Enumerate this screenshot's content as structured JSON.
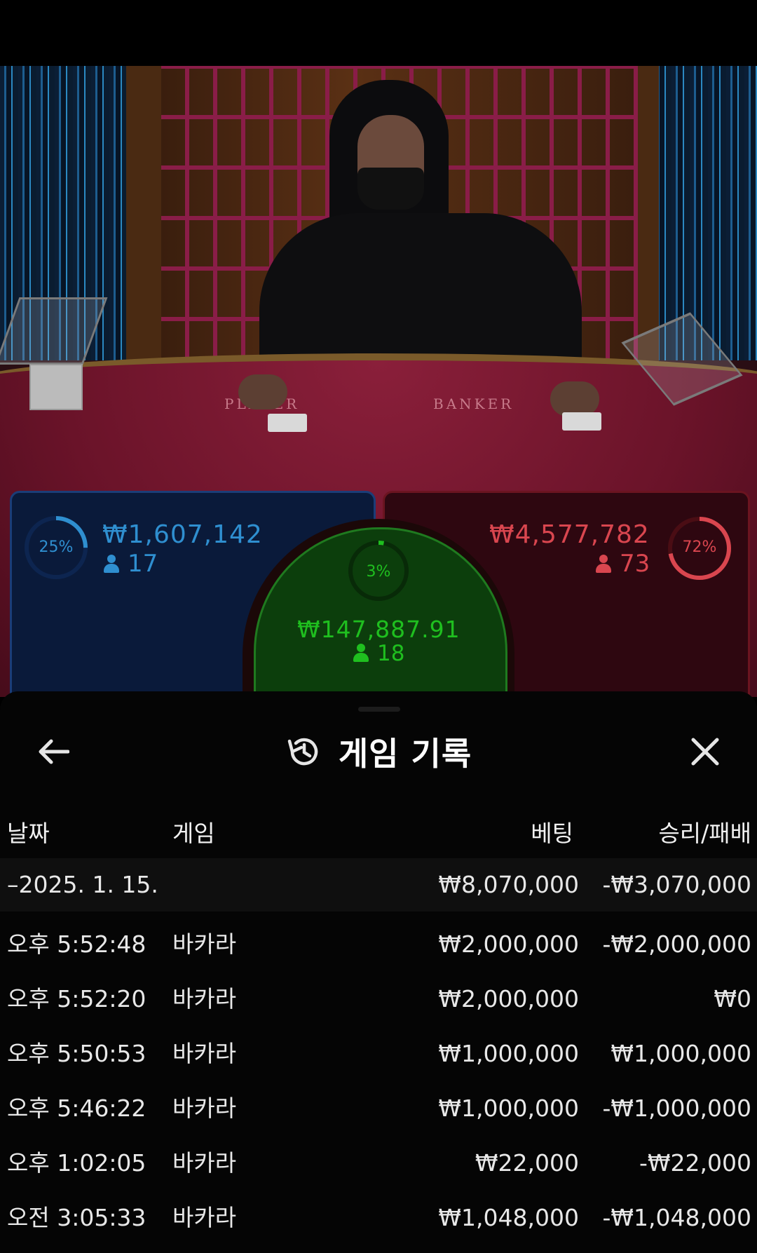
{
  "board": {
    "player": {
      "amount": "₩1,607,142",
      "players": "17",
      "percent": "25%",
      "percent_value": 25,
      "color": "#2f8fd0"
    },
    "banker": {
      "amount": "₩4,577,782",
      "players": "73",
      "percent": "72%",
      "percent_value": 72,
      "color": "#d9464f"
    },
    "tie": {
      "amount": "₩147,887.91",
      "players": "18",
      "percent": "3%",
      "percent_value": 3,
      "color": "#1fbf1f"
    }
  },
  "table_text": {
    "player": "PLAYER",
    "banker": "BANKER"
  },
  "history": {
    "title": "게임 기록",
    "icons": {
      "back": "arrow-left-icon",
      "history": "history-icon",
      "close": "close-icon"
    },
    "columns": {
      "date": "날짜",
      "game": "게임",
      "bet": "베팅",
      "result": "승리/패배"
    },
    "summary": {
      "date": "–2025. 1. 15.",
      "bet": "₩8,070,000",
      "result": "-₩3,070,000"
    },
    "rows": [
      {
        "time": "오후 5:52:48",
        "game": "바카라",
        "bet": "₩2,000,000",
        "result": "-₩2,000,000"
      },
      {
        "time": "오후 5:52:20",
        "game": "바카라",
        "bet": "₩2,000,000",
        "result": "₩0"
      },
      {
        "time": "오후 5:50:53",
        "game": "바카라",
        "bet": "₩1,000,000",
        "result": "₩1,000,000"
      },
      {
        "time": "오후 5:46:22",
        "game": "바카라",
        "bet": "₩1,000,000",
        "result": "-₩1,000,000"
      },
      {
        "time": "오후 1:02:05",
        "game": "바카라",
        "bet": "₩22,000",
        "result": "-₩22,000"
      },
      {
        "time": "오전 3:05:33",
        "game": "바카라",
        "bet": "₩1,048,000",
        "result": "-₩1,048,000"
      }
    ]
  }
}
